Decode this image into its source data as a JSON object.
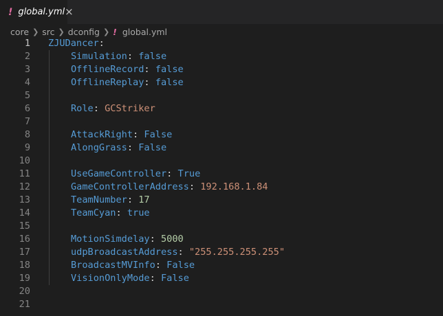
{
  "tab": {
    "icon": "!",
    "title": "global.yml",
    "close": "×"
  },
  "breadcrumb": {
    "parts": [
      "core",
      "src",
      "dconfig"
    ],
    "icon": "!",
    "file": "global.yml"
  },
  "editor": {
    "active_line": 1,
    "lines": [
      {
        "n": "1",
        "indent": false,
        "key": "ZJUDancer",
        "sep": ":",
        "value": "",
        "vtype": ""
      },
      {
        "n": "2",
        "indent": true,
        "key": "Simulation",
        "sep": ": ",
        "value": "false",
        "vtype": "bool"
      },
      {
        "n": "3",
        "indent": true,
        "key": "OfflineRecord",
        "sep": ": ",
        "value": "false",
        "vtype": "bool"
      },
      {
        "n": "4",
        "indent": true,
        "key": "OfflineReplay",
        "sep": ": ",
        "value": "false",
        "vtype": "bool"
      },
      {
        "n": "5",
        "indent": false,
        "key": "",
        "sep": "",
        "value": "",
        "vtype": ""
      },
      {
        "n": "6",
        "indent": true,
        "key": "Role",
        "sep": ": ",
        "value": "GCStriker",
        "vtype": "str"
      },
      {
        "n": "7",
        "indent": false,
        "key": "",
        "sep": "",
        "value": "",
        "vtype": ""
      },
      {
        "n": "8",
        "indent": true,
        "key": "AttackRight",
        "sep": ": ",
        "value": "False",
        "vtype": "bool"
      },
      {
        "n": "9",
        "indent": true,
        "key": "AlongGrass",
        "sep": ": ",
        "value": "False",
        "vtype": "bool"
      },
      {
        "n": "10",
        "indent": false,
        "key": "",
        "sep": "",
        "value": "",
        "vtype": ""
      },
      {
        "n": "11",
        "indent": true,
        "key": "UseGameController",
        "sep": ": ",
        "value": "True",
        "vtype": "bool"
      },
      {
        "n": "12",
        "indent": true,
        "key": "GameControllerAddress",
        "sep": ": ",
        "value": "192.168.1.84",
        "vtype": "str"
      },
      {
        "n": "13",
        "indent": true,
        "key": "TeamNumber",
        "sep": ": ",
        "value": "17",
        "vtype": "num"
      },
      {
        "n": "14",
        "indent": true,
        "key": "TeamCyan",
        "sep": ": ",
        "value": "true",
        "vtype": "bool"
      },
      {
        "n": "15",
        "indent": false,
        "key": "",
        "sep": "",
        "value": "",
        "vtype": ""
      },
      {
        "n": "16",
        "indent": true,
        "key": "MotionSimdelay",
        "sep": ": ",
        "value": "5000",
        "vtype": "num"
      },
      {
        "n": "17",
        "indent": true,
        "key": "udpBroadcastAddress",
        "sep": ": ",
        "value": "\"255.255.255.255\"",
        "vtype": "str"
      },
      {
        "n": "18",
        "indent": true,
        "key": "BroadcastMVInfo",
        "sep": ": ",
        "value": "False",
        "vtype": "bool"
      },
      {
        "n": "19",
        "indent": true,
        "key": "VisionOnlyMode",
        "sep": ": ",
        "value": "False",
        "vtype": "bool"
      },
      {
        "n": "20",
        "indent": false,
        "key": "",
        "sep": "",
        "value": "",
        "vtype": ""
      },
      {
        "n": "21",
        "indent": false,
        "key": "",
        "sep": "",
        "value": "",
        "vtype": ""
      }
    ]
  },
  "colors": {
    "background": "#1e1e1e",
    "key": "#569cd6",
    "string": "#ce9178",
    "number": "#b5cea8",
    "yaml_icon": "#e06ba0"
  }
}
